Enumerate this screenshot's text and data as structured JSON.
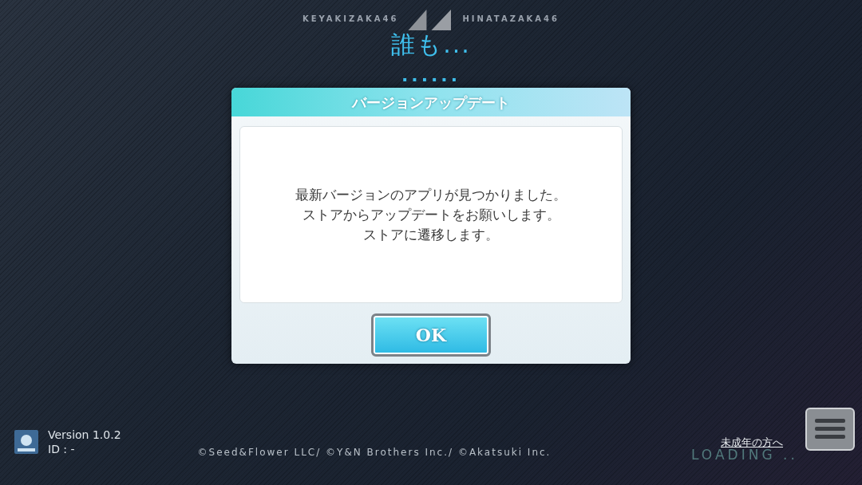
{
  "header": {
    "left_brand": "KEYAKIZAKA46",
    "right_brand": "HINATAZAKA46"
  },
  "lyric": "誰も...",
  "progress_dots": "......",
  "dialog": {
    "title": "バージョンアップデート",
    "message": [
      "最新バージョンのアプリが見つかりました。",
      "ストアからアップデートをお願いします。",
      "ストアに遷移します。"
    ],
    "button": "OK"
  },
  "footer": {
    "version": "Version 1.0.2",
    "id": "ID : -",
    "copyright": "©Seed&Flower LLC/ ©Y&N Brothers Inc./ ©Akatsuki Inc.",
    "minor_link": "未成年の方へ",
    "loading": "LOADING .."
  }
}
